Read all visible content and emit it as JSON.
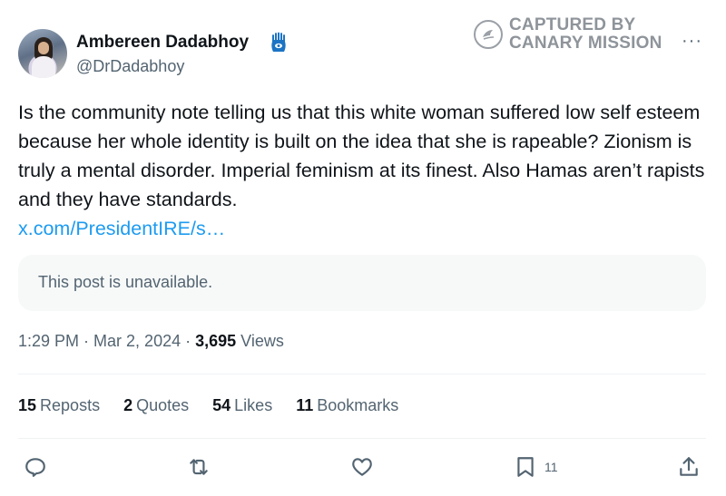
{
  "author": {
    "name": "Ambereen Dadabhoy",
    "handle": "@DrDadabhoy"
  },
  "watermark": {
    "line1": "CAPTURED BY",
    "line2": "CANARY MISSION"
  },
  "more_label": "···",
  "tweet": {
    "text": "Is the community note telling us that this white woman suffered low self esteem because her whole identity is built on the idea that she is rapeable? Zionism is truly a mental disorder. Imperial feminism at its finest. Also Hamas aren’t rapists and they have standards.",
    "link": "x.com/PresidentIRE/s…"
  },
  "quoted_post": {
    "message": "This post is unavailable."
  },
  "meta": {
    "time": "1:29 PM",
    "sep1": " · ",
    "date": "Mar 2, 2024",
    "sep2": " · ",
    "views_count": "3,695",
    "views_label": " Views"
  },
  "stats": {
    "reposts": {
      "count": "15",
      "label": "Reposts"
    },
    "quotes": {
      "count": "2",
      "label": "Quotes"
    },
    "likes": {
      "count": "54",
      "label": "Likes"
    },
    "bookmarks": {
      "count": "11",
      "label": "Bookmarks"
    }
  },
  "actions": {
    "reply_icon": "reply-icon",
    "repost_icon": "repost-icon",
    "like_icon": "heart-icon",
    "bookmark_icon": "bookmark-icon",
    "bookmark_count": "11",
    "share_icon": "share-icon"
  },
  "colors": {
    "text": "#0f1419",
    "secondary": "#536471",
    "link": "#1d9bf0",
    "card_bg": "#f7f9f9",
    "watermark": "#8e949a",
    "hamsa": "#1d74c4"
  }
}
